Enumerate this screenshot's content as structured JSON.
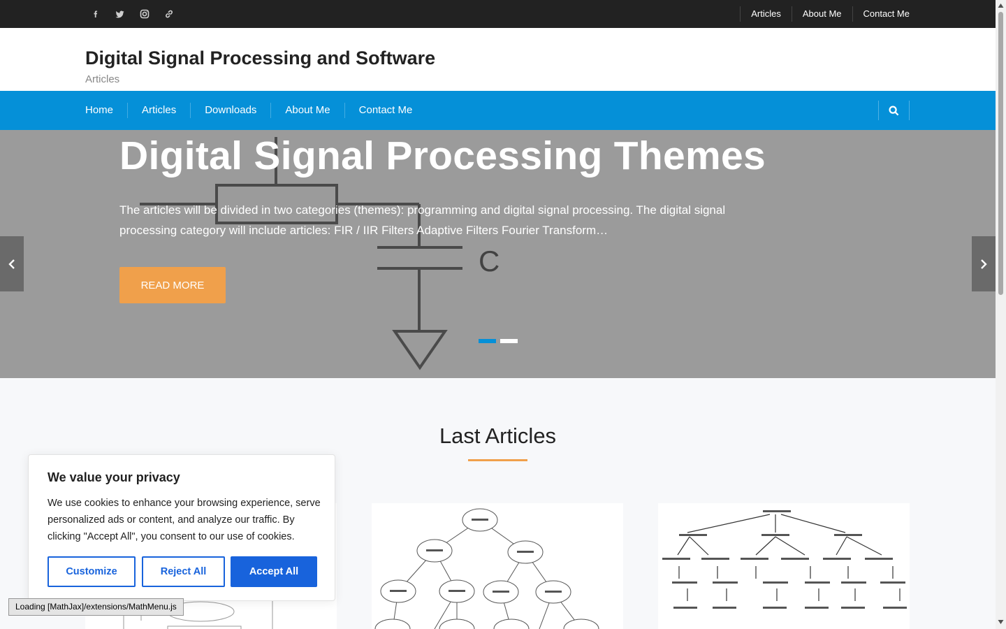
{
  "top_bar": {
    "social_icons": [
      "facebook-icon",
      "twitter-icon",
      "instagram-icon",
      "link-icon"
    ],
    "menu": [
      {
        "label": "Articles"
      },
      {
        "label": "About Me"
      },
      {
        "label": "Contact Me"
      }
    ]
  },
  "header": {
    "site_title": "Digital Signal Processing and Software",
    "site_description": "Articles"
  },
  "nav": {
    "items": [
      {
        "label": "Home"
      },
      {
        "label": "Articles"
      },
      {
        "label": "Downloads"
      },
      {
        "label": "About Me"
      },
      {
        "label": "Contact Me"
      }
    ],
    "search_icon": "search-icon"
  },
  "hero": {
    "title": "Digital Signal Processing Themes",
    "text": "The articles will be divided in two categories (themes): programming and digital signal processing. The digital signal processing category will include articles: FIR / IIR Filters Adaptive Filters Fourier Transform…",
    "read_more": "READ MORE",
    "capacitor_label": "C",
    "slides_total": 2,
    "active_slide": 1
  },
  "last_articles": {
    "title": "Last Articles"
  },
  "cookie": {
    "title": "We value your privacy",
    "text": "We use cookies to enhance your browsing experience, serve personalized ads or content, and analyze our traffic. By clicking \"Accept All\", you consent to our use of cookies.",
    "customize": "Customize",
    "reject": "Reject All",
    "accept": "Accept All"
  },
  "status": {
    "mathjax": "Loading [MathJax]/extensions/MathMenu.js"
  },
  "colors": {
    "top_bar": "#222222",
    "nav": "#0590d8",
    "accent": "#f0a04b",
    "cookie_button": "#1863dc"
  }
}
